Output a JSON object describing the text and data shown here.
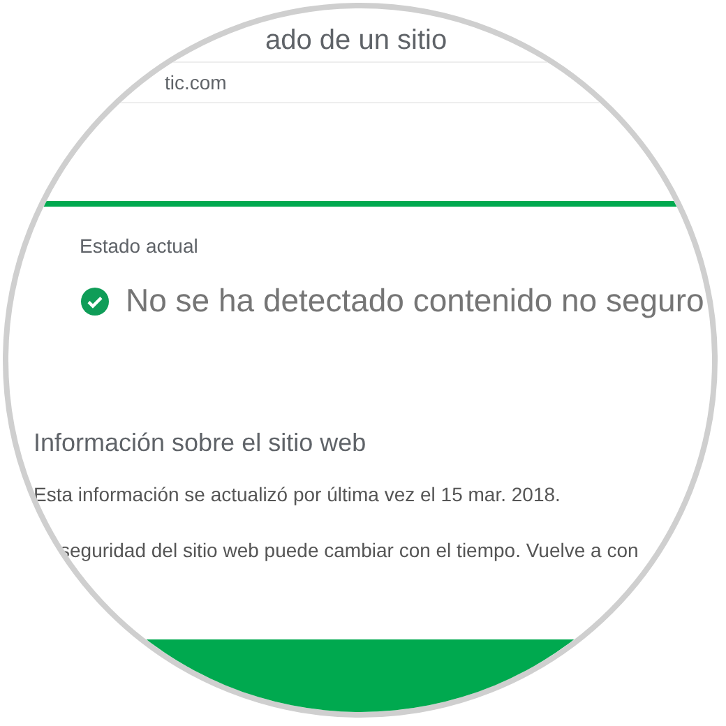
{
  "page_title": "ado de un sitio",
  "url_field": {
    "value": "tic.com"
  },
  "status": {
    "label": "Estado actual",
    "safe": true,
    "message": "No se ha detectado contenido no seguro"
  },
  "info": {
    "heading": "Información sobre el sitio web",
    "paragraphs": [
      "Esta información se actualizó por última vez el 15 mar. 2018.",
      "seguridad del sitio web puede cambiar con el tiempo. Vuelve a con"
    ]
  }
}
